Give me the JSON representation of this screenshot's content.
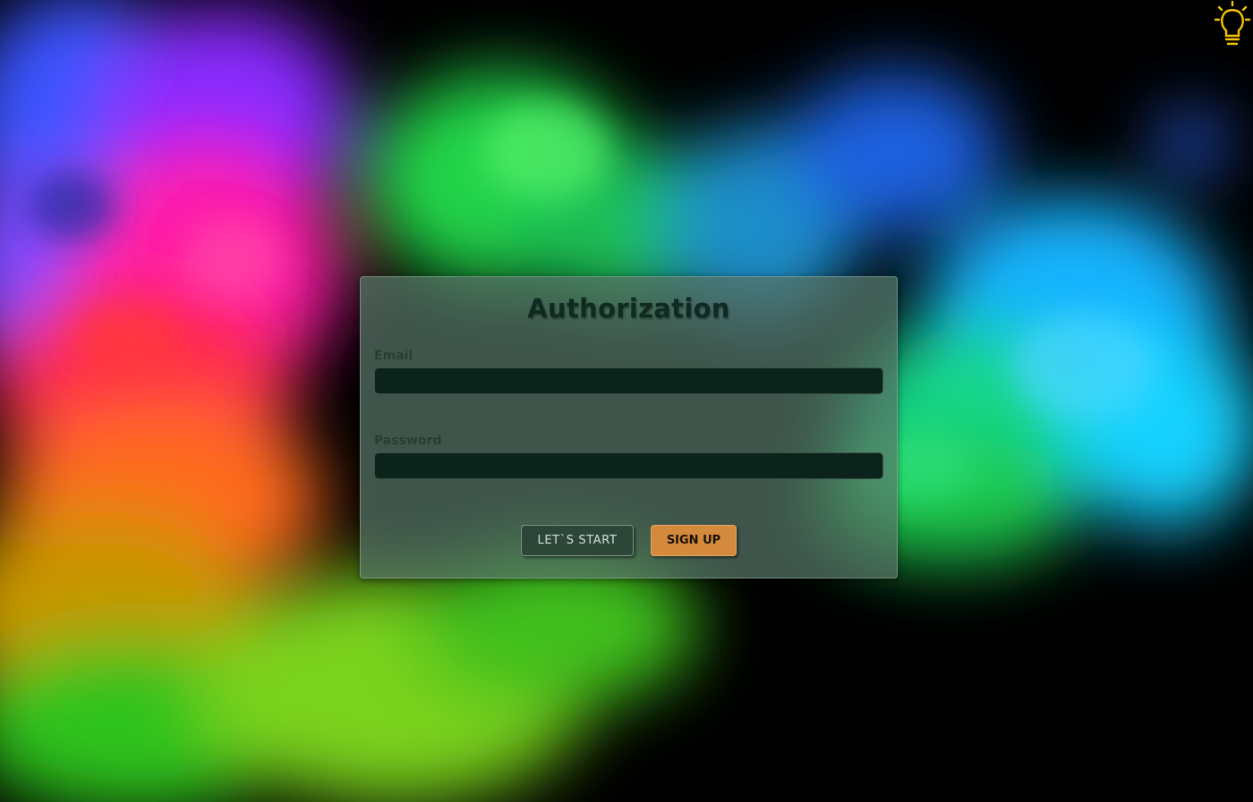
{
  "auth_form": {
    "title": "Authorization",
    "email_label": "Email",
    "email_value": "",
    "password_label": "Password",
    "password_value": "",
    "start_button_label": "LET`S START",
    "signup_button_label": "SIGN UP"
  },
  "header": {
    "theme_toggle_icon": "lightbulb-icon"
  },
  "colors": {
    "card_background": "#587668",
    "input_background": "#0b231a",
    "title_text": "#0f2a20",
    "start_button": "#2c4638",
    "signup_button": "#d38a3c",
    "lightbulb_icon": "#f5c400"
  }
}
